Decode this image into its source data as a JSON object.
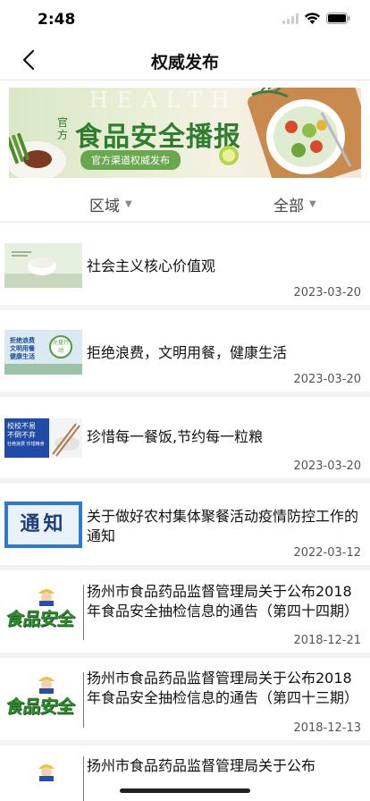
{
  "status": {
    "time": "2:48"
  },
  "nav": {
    "title": "权威发布"
  },
  "banner": {
    "watermark": "HEALTH",
    "prefix": "官方",
    "title": "食品安全播报",
    "subtitle": "官方渠道权威发布"
  },
  "filters": {
    "region": "区域",
    "all": "全部"
  },
  "thumb_text": {
    "notice": "通知",
    "food_safety": "食品安全",
    "thrift_line1": "校校不易",
    "thrift_line2": "不倒不弃",
    "thrift_line3": "杜绝浪费 珍惜粮食",
    "waste_line1": "拒绝浪费",
    "waste_line2": "文明用餐",
    "waste_line3": "健康生活",
    "waste_badge": "光盘行动"
  },
  "news": [
    {
      "title": "社会主义核心价值观",
      "date": "2023-03-20",
      "thumb": "values"
    },
    {
      "title": "拒绝浪费，文明用餐，健康生活",
      "date": "2023-03-20",
      "thumb": "waste"
    },
    {
      "title": "珍惜每一餐饭,节约每一粒粮",
      "date": "2023-03-20",
      "thumb": "thrift"
    },
    {
      "title": "关于做好农村集体聚餐活动疫情防控工作的通知",
      "date": "2022-03-12",
      "thumb": "notice"
    },
    {
      "title": "扬州市食品药品监督管理局关于公布2018年食品安全抽检信息的通告（第四十四期）",
      "date": "2018-12-21",
      "thumb": "food-safety"
    },
    {
      "title": "扬州市食品药品监督管理局关于公布2018年食品安全抽检信息的通告（第四十三期）",
      "date": "2018-12-13",
      "thumb": "food-safety"
    },
    {
      "title": "扬州市食品药品监督管理局关于公布",
      "date": "",
      "thumb": "food-safety"
    }
  ],
  "colors": {
    "banner_green": "#2f7d2f",
    "notice_blue": "#2b7bd6"
  }
}
